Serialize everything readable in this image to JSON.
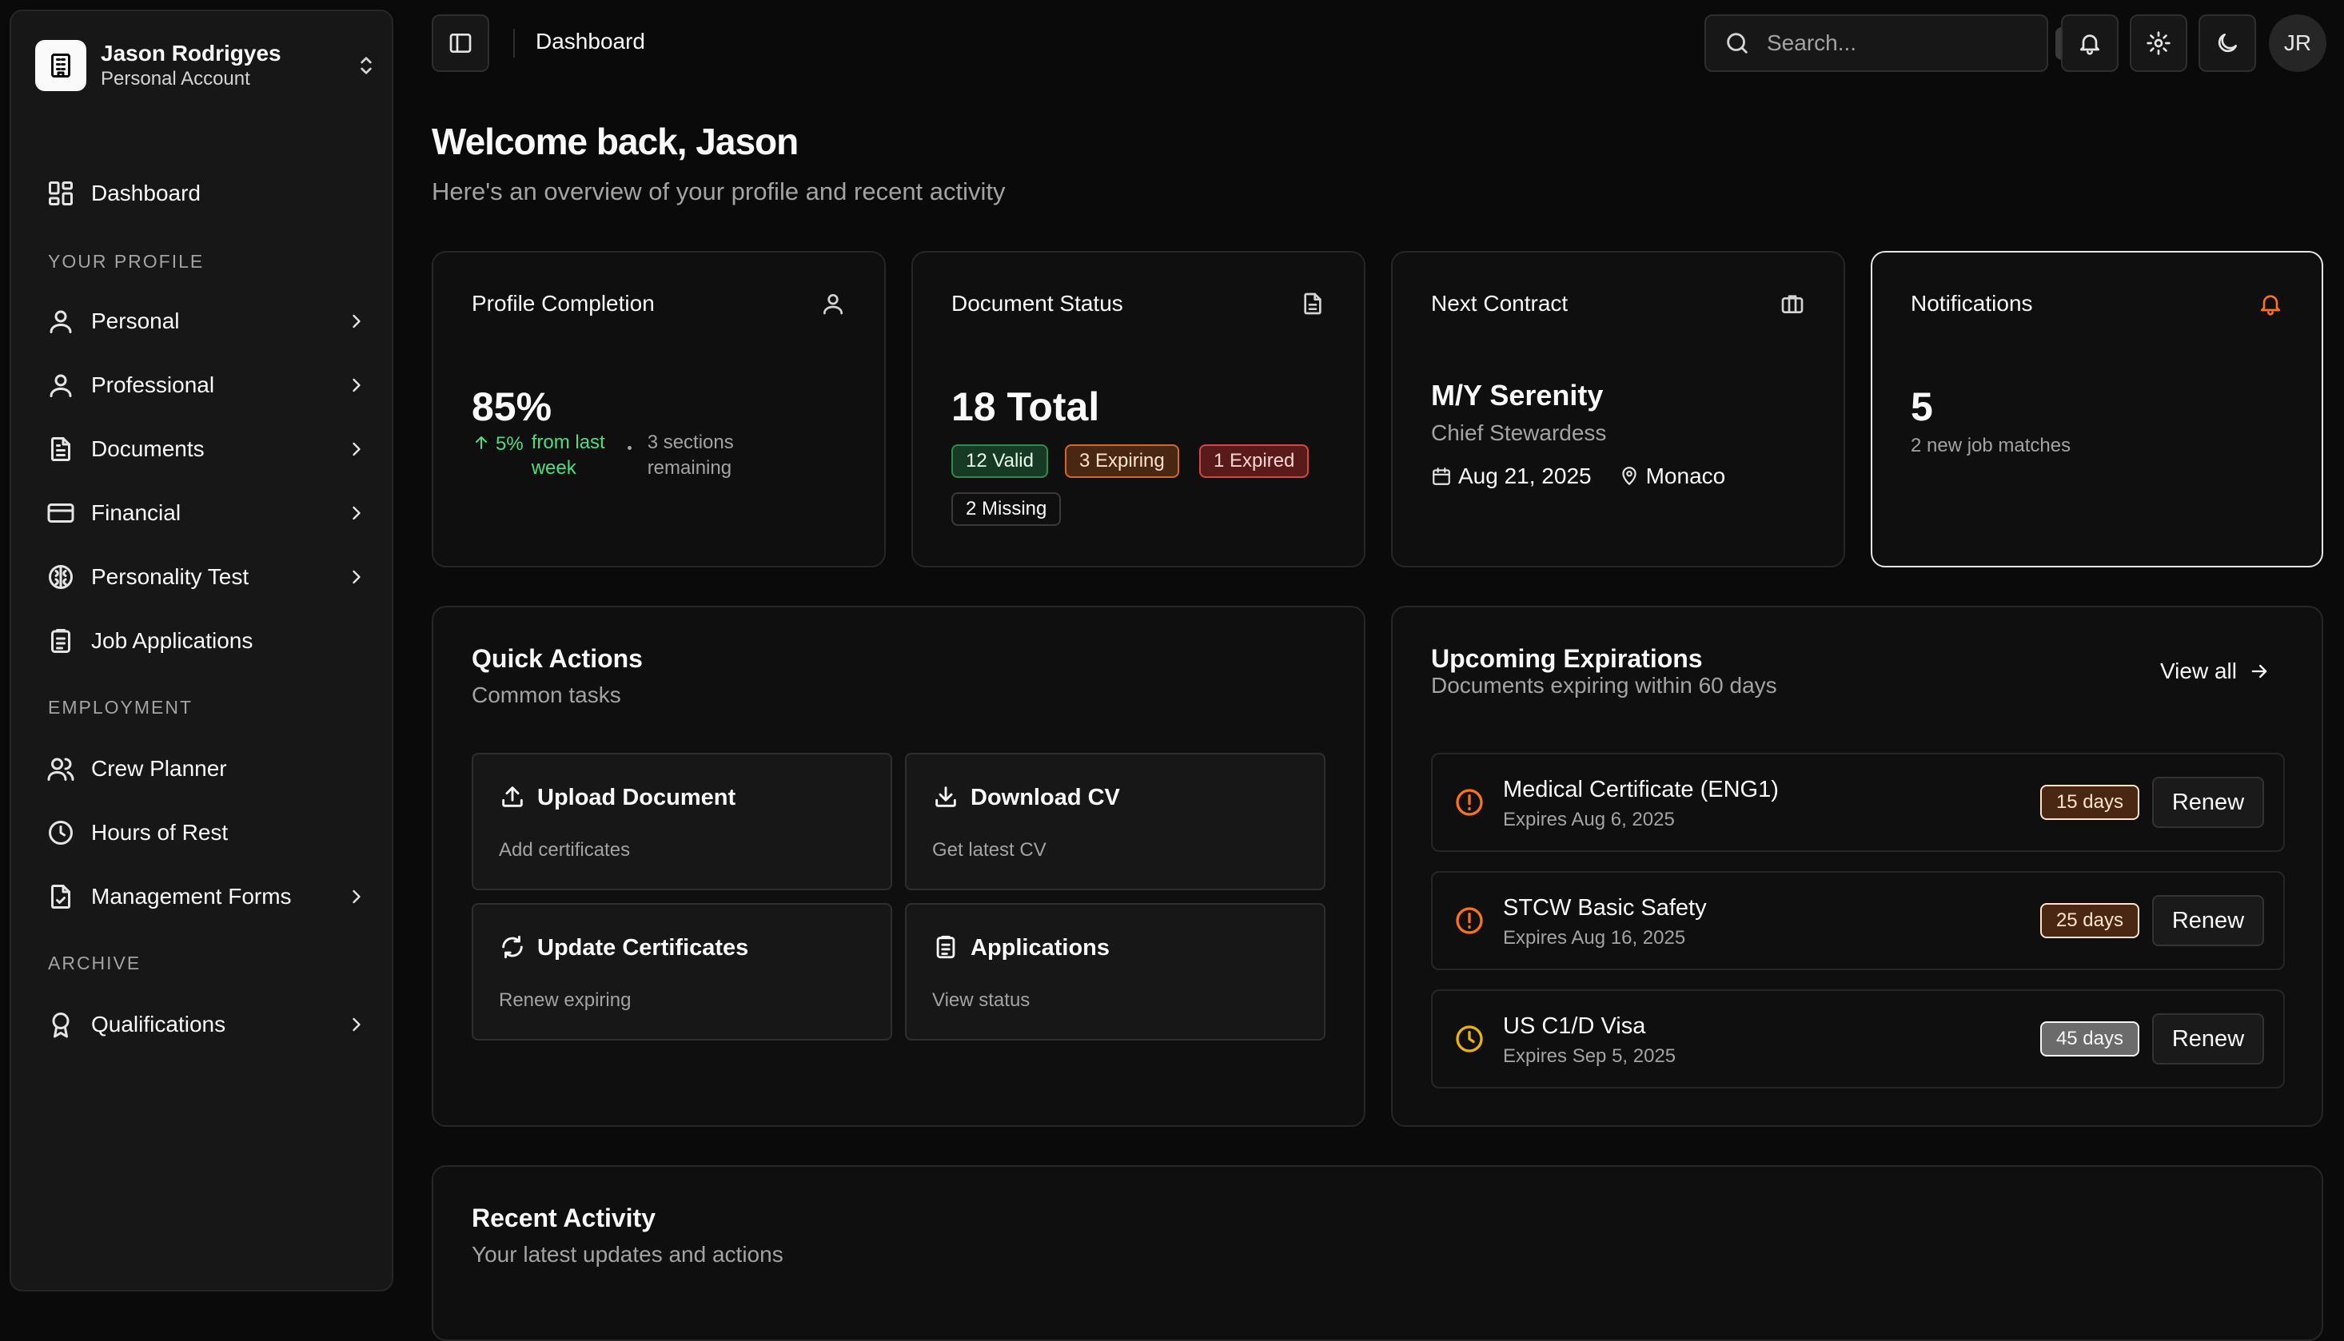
{
  "account": {
    "name": "Jason Rodrigyes",
    "type": "Personal Account",
    "initials": "JR"
  },
  "sidebar": {
    "dashboard": "Dashboard",
    "sections": {
      "profile": "YOUR PROFILE",
      "employment": "EMPLOYMENT",
      "archive": "ARCHIVE"
    },
    "profile_items": [
      {
        "label": "Personal",
        "icon": "user-icon"
      },
      {
        "label": "Professional",
        "icon": "user-icon"
      },
      {
        "label": "Documents",
        "icon": "file-text-icon"
      },
      {
        "label": "Financial",
        "icon": "credit-card-icon"
      },
      {
        "label": "Personality Test",
        "icon": "brain-icon"
      },
      {
        "label": "Job Applications",
        "icon": "clipboard-icon"
      }
    ],
    "employment_items": [
      {
        "label": "Crew Planner",
        "icon": "users-icon"
      },
      {
        "label": "Hours of Rest",
        "icon": "clock-icon"
      },
      {
        "label": "Management Forms",
        "icon": "file-check-icon"
      }
    ],
    "archive_items": [
      {
        "label": "Qualifications",
        "icon": "award-icon"
      }
    ]
  },
  "header": {
    "breadcrumb": "Dashboard",
    "search_placeholder": "Search...",
    "search_shortcut": "⌘k"
  },
  "welcome": {
    "title": "Welcome back, Jason",
    "subtitle": "Here's an overview of your profile and recent activity"
  },
  "cards": {
    "profile": {
      "title": "Profile Completion",
      "value": "85%",
      "trend_pct": "5%",
      "trend_text": "from last week",
      "remaining": "3 sections remaining"
    },
    "documents": {
      "title": "Document Status",
      "value": "18 Total",
      "valid": "12 Valid",
      "expiring": "3 Expiring",
      "expired": "1 Expired",
      "missing": "2 Missing"
    },
    "contract": {
      "title": "Next Contract",
      "vessel": "M/Y Serenity",
      "role": "Chief Stewardess",
      "date": "Aug 21, 2025",
      "location": "Monaco"
    },
    "notifications": {
      "title": "Notifications",
      "value": "5",
      "subtitle": "2 new job matches"
    }
  },
  "quick_actions": {
    "title": "Quick Actions",
    "subtitle": "Common tasks",
    "items": [
      {
        "title": "Upload Document",
        "sub": "Add certificates"
      },
      {
        "title": "Download CV",
        "sub": "Get latest CV"
      },
      {
        "title": "Update Certificates",
        "sub": "Renew expiring"
      },
      {
        "title": "Applications",
        "sub": "View status"
      }
    ]
  },
  "expirations": {
    "title": "Upcoming Expirations",
    "subtitle": "Documents expiring within 60 days",
    "view_all": "View all",
    "renew_label": "Renew",
    "items": [
      {
        "name": "Medical Certificate (ENG1)",
        "expires": "Expires Aug 6, 2025",
        "days": "15 days",
        "level": "warning"
      },
      {
        "name": "STCW Basic Safety",
        "expires": "Expires Aug 16, 2025",
        "days": "25 days",
        "level": "warning"
      },
      {
        "name": "US C1/D Visa",
        "expires": "Expires Sep 5, 2025",
        "days": "45 days",
        "level": "normal"
      }
    ]
  },
  "recent_activity": {
    "title": "Recent Activity",
    "subtitle": "Your latest updates and actions"
  },
  "colors": {
    "background": "#0a0a0a",
    "success": "#4ade80",
    "warning": "#f97316",
    "danger": "#ef4444",
    "caution": "#eab308"
  }
}
